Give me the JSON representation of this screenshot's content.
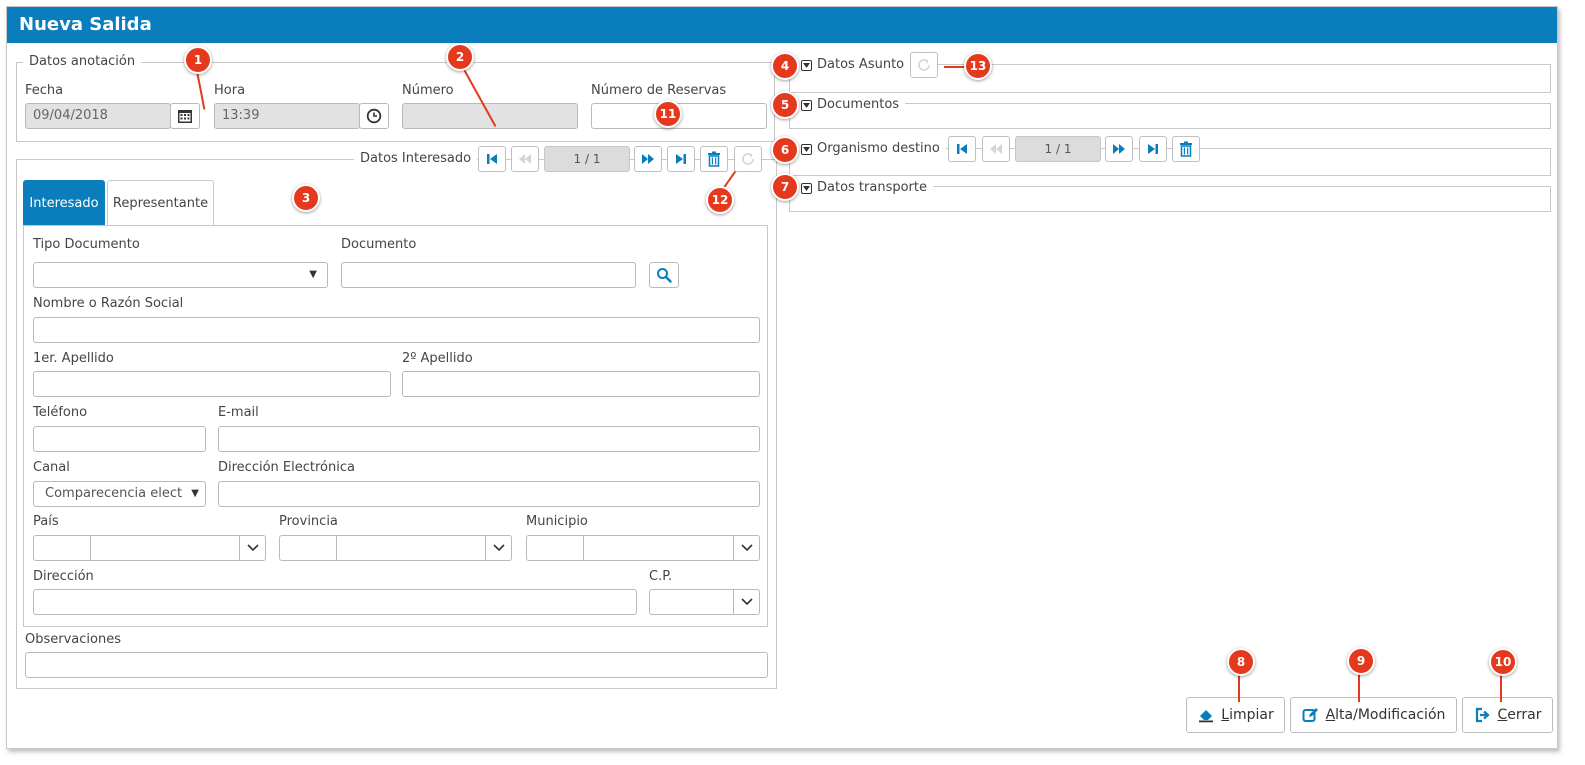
{
  "window": {
    "title": "Nueva Salida"
  },
  "datos_anotacion": {
    "legend": "Datos anotación",
    "fecha": {
      "label": "Fecha",
      "value": "09/04/2018"
    },
    "hora": {
      "label": "Hora",
      "value": "13:39"
    },
    "numero": {
      "label": "Número",
      "value": ""
    },
    "reservas": {
      "label": "Número de Reservas",
      "value": ""
    }
  },
  "datos_interesado": {
    "legend": "Datos Interesado",
    "pager": "1 / 1",
    "tabs": [
      "Interesado",
      "Representante"
    ],
    "tipo_documento": {
      "label": "Tipo Documento",
      "value": ""
    },
    "documento": {
      "label": "Documento",
      "value": ""
    },
    "nombre": {
      "label": "Nombre o Razón Social",
      "value": ""
    },
    "apellido1": {
      "label": "1er. Apellido",
      "value": ""
    },
    "apellido2": {
      "label": "2º Apellido",
      "value": ""
    },
    "telefono": {
      "label": "Teléfono",
      "value": ""
    },
    "email": {
      "label": "E-mail",
      "value": ""
    },
    "canal": {
      "label": "Canal",
      "value": "Comparecencia elect"
    },
    "direccion_electronica": {
      "label": "Dirección Electrónica",
      "value": ""
    },
    "pais": {
      "label": "País"
    },
    "provincia": {
      "label": "Provincia"
    },
    "municipio": {
      "label": "Municipio"
    },
    "direccion": {
      "label": "Dirección",
      "value": ""
    },
    "cp": {
      "label": "C.P."
    },
    "observaciones": {
      "label": "Observaciones",
      "value": ""
    }
  },
  "right_panel": {
    "datos_asunto": "Datos Asunto",
    "documentos": "Documentos",
    "organismo_destino": "Organismo destino",
    "organismo_pager": "1 / 1",
    "datos_transporte": "Datos transporte"
  },
  "actions": {
    "limpiar_first": "L",
    "limpiar_rest": "impiar",
    "alta_first": "A",
    "alta_rest": "lta/Modificación",
    "cerrar_first": "C",
    "cerrar_rest": "errar"
  },
  "badges": [
    "1",
    "2",
    "3",
    "4",
    "5",
    "6",
    "7",
    "8",
    "9",
    "10",
    "11",
    "12",
    "13"
  ],
  "colors": {
    "accent": "#0a7dbd",
    "badge": "#e5391e",
    "disabled_field": "#e2e2e2"
  }
}
